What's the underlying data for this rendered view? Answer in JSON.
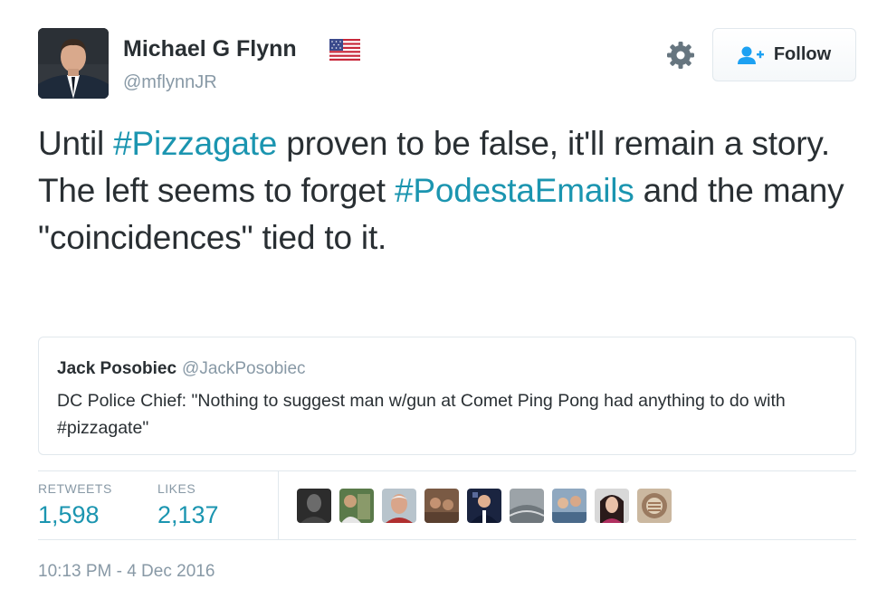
{
  "author": {
    "display_name": "Michael G Flynn",
    "handle": "@mflynnJR",
    "flag_icon": "us-flag-icon",
    "avatar_icon": "profile-photo"
  },
  "actions": {
    "settings_icon": "gear-icon",
    "follow_icon": "add-user-icon",
    "follow_label": "Follow"
  },
  "tweet": {
    "segments": [
      {
        "text": "Until ",
        "type": "text"
      },
      {
        "text": "#Pizzagate",
        "type": "hashtag"
      },
      {
        "text": " proven to be false, it'll remain a story. The left seems to forget ",
        "type": "text"
      },
      {
        "text": "#PodestaEmails",
        "type": "hashtag"
      },
      {
        "text": " and the many \"coincidences\" tied to it.",
        "type": "text"
      }
    ]
  },
  "quoted_tweet": {
    "name": "Jack Posobiec",
    "handle": "@JackPosobiec",
    "text": "DC Police Chief: \"Nothing to suggest man w/gun at Comet Ping Pong had anything to do with #pizzagate\""
  },
  "stats": {
    "retweets_label": "RETWEETS",
    "retweets_value": "1,598",
    "likes_label": "LIKES",
    "likes_value": "2,137"
  },
  "likers": [
    "liker-avatar-1",
    "liker-avatar-2",
    "liker-avatar-3",
    "liker-avatar-4",
    "liker-avatar-5",
    "liker-avatar-6",
    "liker-avatar-7",
    "liker-avatar-8",
    "liker-avatar-9"
  ],
  "timestamp": "10:13 PM - 4 Dec 2016",
  "colors": {
    "link": "#1b95b0",
    "muted": "#8899a6",
    "text": "#292f33",
    "border": "#e1e8ed",
    "follow_icon": "#1da1f2"
  }
}
